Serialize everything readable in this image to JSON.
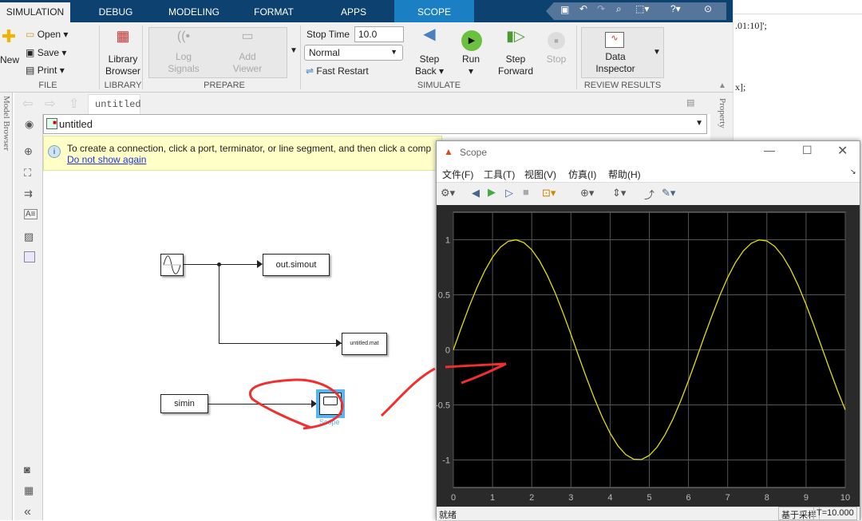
{
  "ribbon_tabs": [
    "SIMULATION",
    "DEBUG",
    "MODELING",
    "FORMAT",
    "APPS",
    "SCOPE"
  ],
  "file": {
    "new": "New",
    "open": "Open",
    "save": "Save",
    "print": "Print",
    "section": "FILE"
  },
  "library": {
    "label1": "Library",
    "label2": "Browser",
    "section": "LIBRARY"
  },
  "prepare": {
    "log1": "Log",
    "log2": "Signals",
    "add1": "Add",
    "add2": "Viewer",
    "section": "PREPARE"
  },
  "simulate": {
    "stop_time_label": "Stop Time",
    "stop_time_value": "10.0",
    "mode": "Normal",
    "fast_restart": "Fast Restart",
    "step_back1": "Step",
    "step_back2": "Back",
    "run": "Run",
    "step_fwd1": "Step",
    "step_fwd2": "Forward",
    "stop": "Stop",
    "section": "SIMULATE"
  },
  "review": {
    "label1": "Data",
    "label2": "Inspector",
    "section": "REVIEW RESULTS"
  },
  "editor": {
    "line1": ".01:10]';",
    "line2": "x];"
  },
  "doc_tab": "untitled",
  "address": "untitled",
  "side_labels": {
    "model_browser": "Model Browser",
    "property": "Property"
  },
  "info": {
    "message": "To create a connection, click a port, terminator, or line segment, and then click a comp",
    "link": "Do not show again"
  },
  "blocks": {
    "simout": "out.simout",
    "mat": "untitled.mat",
    "simin": "simin",
    "scope": "Scope"
  },
  "scope_window": {
    "title": "Scope",
    "menu": [
      "文件(F)",
      "工具(T)",
      "视图(V)",
      "仿真(I)",
      "帮助(H)"
    ],
    "status_left": "就绪",
    "status_mode": "基于采样",
    "status_time": "T=10.000"
  },
  "chart_data": {
    "type": "line",
    "xlim": [
      0,
      10
    ],
    "ylim": [
      -1.25,
      1.25
    ],
    "xticks": [
      0,
      1,
      2,
      3,
      4,
      5,
      6,
      7,
      8,
      9,
      10
    ],
    "yticks": [
      -1,
      -0.5,
      0,
      0.5,
      1
    ],
    "ytick_labels": [
      "-1",
      "-0.5",
      "0",
      "0.5",
      "1"
    ],
    "grid": true,
    "series": [
      {
        "function": "sin(t)",
        "t_start": 0,
        "t_end": 10,
        "t_step": 0.2,
        "color": "#e0e000"
      }
    ],
    "background": "#000000"
  }
}
